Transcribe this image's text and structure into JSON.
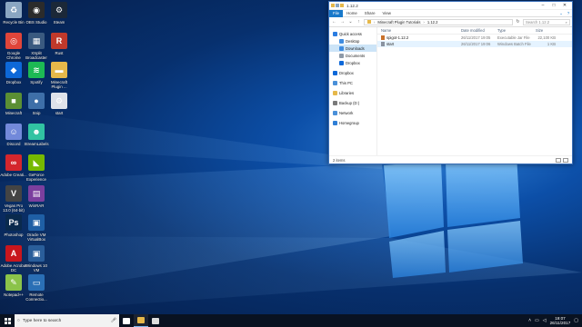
{
  "desktop": {
    "icons": [
      {
        "label": "Recycle Bin",
        "icon": "recycle-bin-icon",
        "color": "#8aa6c2",
        "glyph": "♻"
      },
      {
        "label": "OBS Studio",
        "icon": "obs-icon",
        "color": "#2b2b2b",
        "glyph": "◉"
      },
      {
        "label": "Steam",
        "icon": "steam-icon",
        "color": "#1b2838",
        "glyph": "⚙"
      },
      {
        "label": "Google Chrome",
        "icon": "chrome-icon",
        "color": "#e0453a",
        "glyph": "◎"
      },
      {
        "label": "XSplit Broadcaster",
        "icon": "xsplit-icon",
        "color": "#3a5a80",
        "glyph": "▦"
      },
      {
        "label": "Rust",
        "icon": "rust-icon",
        "color": "#c0392b",
        "glyph": "R"
      },
      {
        "label": "Dropbox",
        "icon": "dropbox-icon",
        "color": "#0d68d8",
        "glyph": "◆"
      },
      {
        "label": "Spotify",
        "icon": "spotify-icon",
        "color": "#1db954",
        "glyph": "≋"
      },
      {
        "label": "Minecraft Plugin ...",
        "icon": "folder-icon",
        "color": "#e6b84a",
        "glyph": "▬"
      },
      {
        "label": "Minecraft",
        "icon": "minecraft-icon",
        "color": "#5b8f34",
        "glyph": "■"
      },
      {
        "label": "Snip",
        "icon": "snip-icon",
        "color": "#3e6fa8",
        "glyph": "●"
      },
      {
        "label": "start",
        "icon": "batch-file-icon",
        "color": "#dfe3ea",
        "glyph": "⚙"
      },
      {
        "label": "Discord",
        "icon": "discord-icon",
        "color": "#7289da",
        "glyph": "☺"
      },
      {
        "label": "StreamLabels",
        "icon": "streamlabels-icon",
        "color": "#31c3a2",
        "glyph": "☻"
      },
      {
        "label": "Adobe Creati...",
        "icon": "adobe-cc-icon",
        "color": "#d4262d",
        "glyph": "∞"
      },
      {
        "label": "GeForce Experience",
        "icon": "geforce-icon",
        "color": "#76b900",
        "glyph": "◣"
      },
      {
        "label": "Vegas Pro 13.0 (64-bit)",
        "icon": "vegas-icon",
        "color": "#444",
        "glyph": "V"
      },
      {
        "label": "WinRAR",
        "icon": "winrar-icon",
        "color": "#7b3f9e",
        "glyph": "▤"
      },
      {
        "label": "Photoshop",
        "icon": "photoshop-icon",
        "color": "#0a2a4d",
        "glyph": "Ps"
      },
      {
        "label": "Oracle VM VirtualBox",
        "icon": "virtualbox-icon",
        "color": "#1f5fa5",
        "glyph": "▣"
      },
      {
        "label": "Adobe Acrobat DC",
        "icon": "acrobat-icon",
        "color": "#c8161d",
        "glyph": "A"
      },
      {
        "label": "Windows 10 VM",
        "icon": "vm-icon",
        "color": "#2a5e9a",
        "glyph": "▣"
      },
      {
        "label": "Notepad++",
        "icon": "notepadpp-icon",
        "color": "#8bc34a",
        "glyph": "✎"
      },
      {
        "label": "Remote Connectio...",
        "icon": "remote-desktop-icon",
        "color": "#2a6fb5",
        "glyph": "▭"
      }
    ]
  },
  "explorer": {
    "title": "1.12.2",
    "tabs": [
      "File",
      "Home",
      "Share",
      "View"
    ],
    "breadcrumb": [
      "Minecraft Plugin Tutorials",
      "1.12.2"
    ],
    "search_placeholder": "Search 1.12.2",
    "columns": {
      "name": "Name",
      "date": "Date modified",
      "type": "Type",
      "size": "Size"
    },
    "nav": [
      {
        "label": "Quick access",
        "icon": "star-icon",
        "color": "#2b7de1",
        "indent": false,
        "selected": false
      },
      {
        "label": "Desktop",
        "icon": "desktop-icon",
        "color": "#3f8ce0",
        "indent": true,
        "selected": false
      },
      {
        "label": "Downloads",
        "icon": "downloads-icon",
        "color": "#3f8ce0",
        "indent": true,
        "selected": true
      },
      {
        "label": "Documents",
        "icon": "documents-icon",
        "color": "#8e9aa8",
        "indent": true,
        "selected": false
      },
      {
        "label": "Dropbox",
        "icon": "dropbox-icon",
        "color": "#0d68d8",
        "indent": true,
        "selected": false
      },
      {
        "gap": true
      },
      {
        "label": "Dropbox",
        "icon": "dropbox-icon",
        "color": "#0d68d8",
        "indent": false,
        "selected": false
      },
      {
        "gap": true
      },
      {
        "label": "This PC",
        "icon": "computer-icon",
        "color": "#4a90d9",
        "indent": false,
        "selected": false
      },
      {
        "gap": true
      },
      {
        "label": "Libraries",
        "icon": "libraries-icon",
        "color": "#e6b84a",
        "indent": false,
        "selected": false
      },
      {
        "gap": true
      },
      {
        "label": "Backup (D:)",
        "icon": "drive-icon",
        "color": "#7a7a7a",
        "indent": false,
        "selected": false
      },
      {
        "gap": true
      },
      {
        "label": "Network",
        "icon": "network-icon",
        "color": "#4a90d9",
        "indent": false,
        "selected": false
      },
      {
        "gap": true
      },
      {
        "label": "Homegroup",
        "icon": "homegroup-icon",
        "color": "#2f7fd6",
        "indent": false,
        "selected": false
      }
    ],
    "files": [
      {
        "name": "spigot-1.12.2",
        "date": "26/11/2017 19:05",
        "type": "Executable Jar File",
        "size": "22,100 KB",
        "icon": "jar-file-icon",
        "color": "#c8712a",
        "hover": false
      },
      {
        "name": "start",
        "date": "26/11/2017 19:06",
        "type": "Windows Batch File",
        "size": "1 KB",
        "icon": "batch-file-icon",
        "color": "#8a93a0",
        "hover": true
      }
    ],
    "status": "2 items"
  },
  "taskbar": {
    "search_placeholder": "Type here to search",
    "apps": [
      {
        "icon": "task-view-icon",
        "color": "#ffffff",
        "active": false
      },
      {
        "icon": "file-explorer-icon",
        "color": "#e6b84a",
        "active": true
      },
      {
        "icon": "store-icon",
        "color": "#dddddd",
        "active": false
      }
    ],
    "time": "19:07",
    "date": "26/11/2017"
  }
}
